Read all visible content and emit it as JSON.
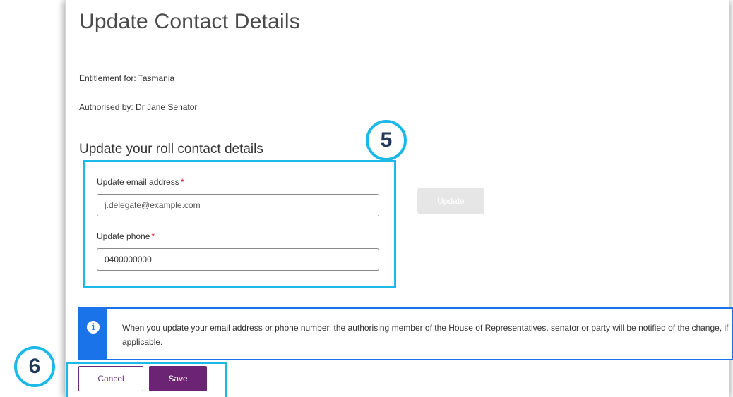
{
  "page": {
    "title": "Update Contact Details",
    "entitlement": "Entitlement for: Tasmania",
    "authorised": "Authorised by: Dr Jane Senator"
  },
  "form": {
    "heading": "Update your roll contact details",
    "email_label": "Update email address",
    "email_value": "j.delegate@example.com",
    "phone_label": "Update phone",
    "phone_value": "0400000000",
    "required_marker": "*",
    "update_label": "Update"
  },
  "info": {
    "icon": "info-icon",
    "text": "When you update your email address or phone number, the authorising member of the House of Representatives, senator or party will be notified of the change, if applicable."
  },
  "actions": {
    "cancel_label": "Cancel",
    "save_label": "Save"
  },
  "callouts": {
    "step_5": "5",
    "step_6": "6"
  },
  "colors": {
    "callout": "#1cb8e8",
    "info_accent": "#1a73e8",
    "primary": "#6b2374",
    "required": "#d0021b"
  }
}
